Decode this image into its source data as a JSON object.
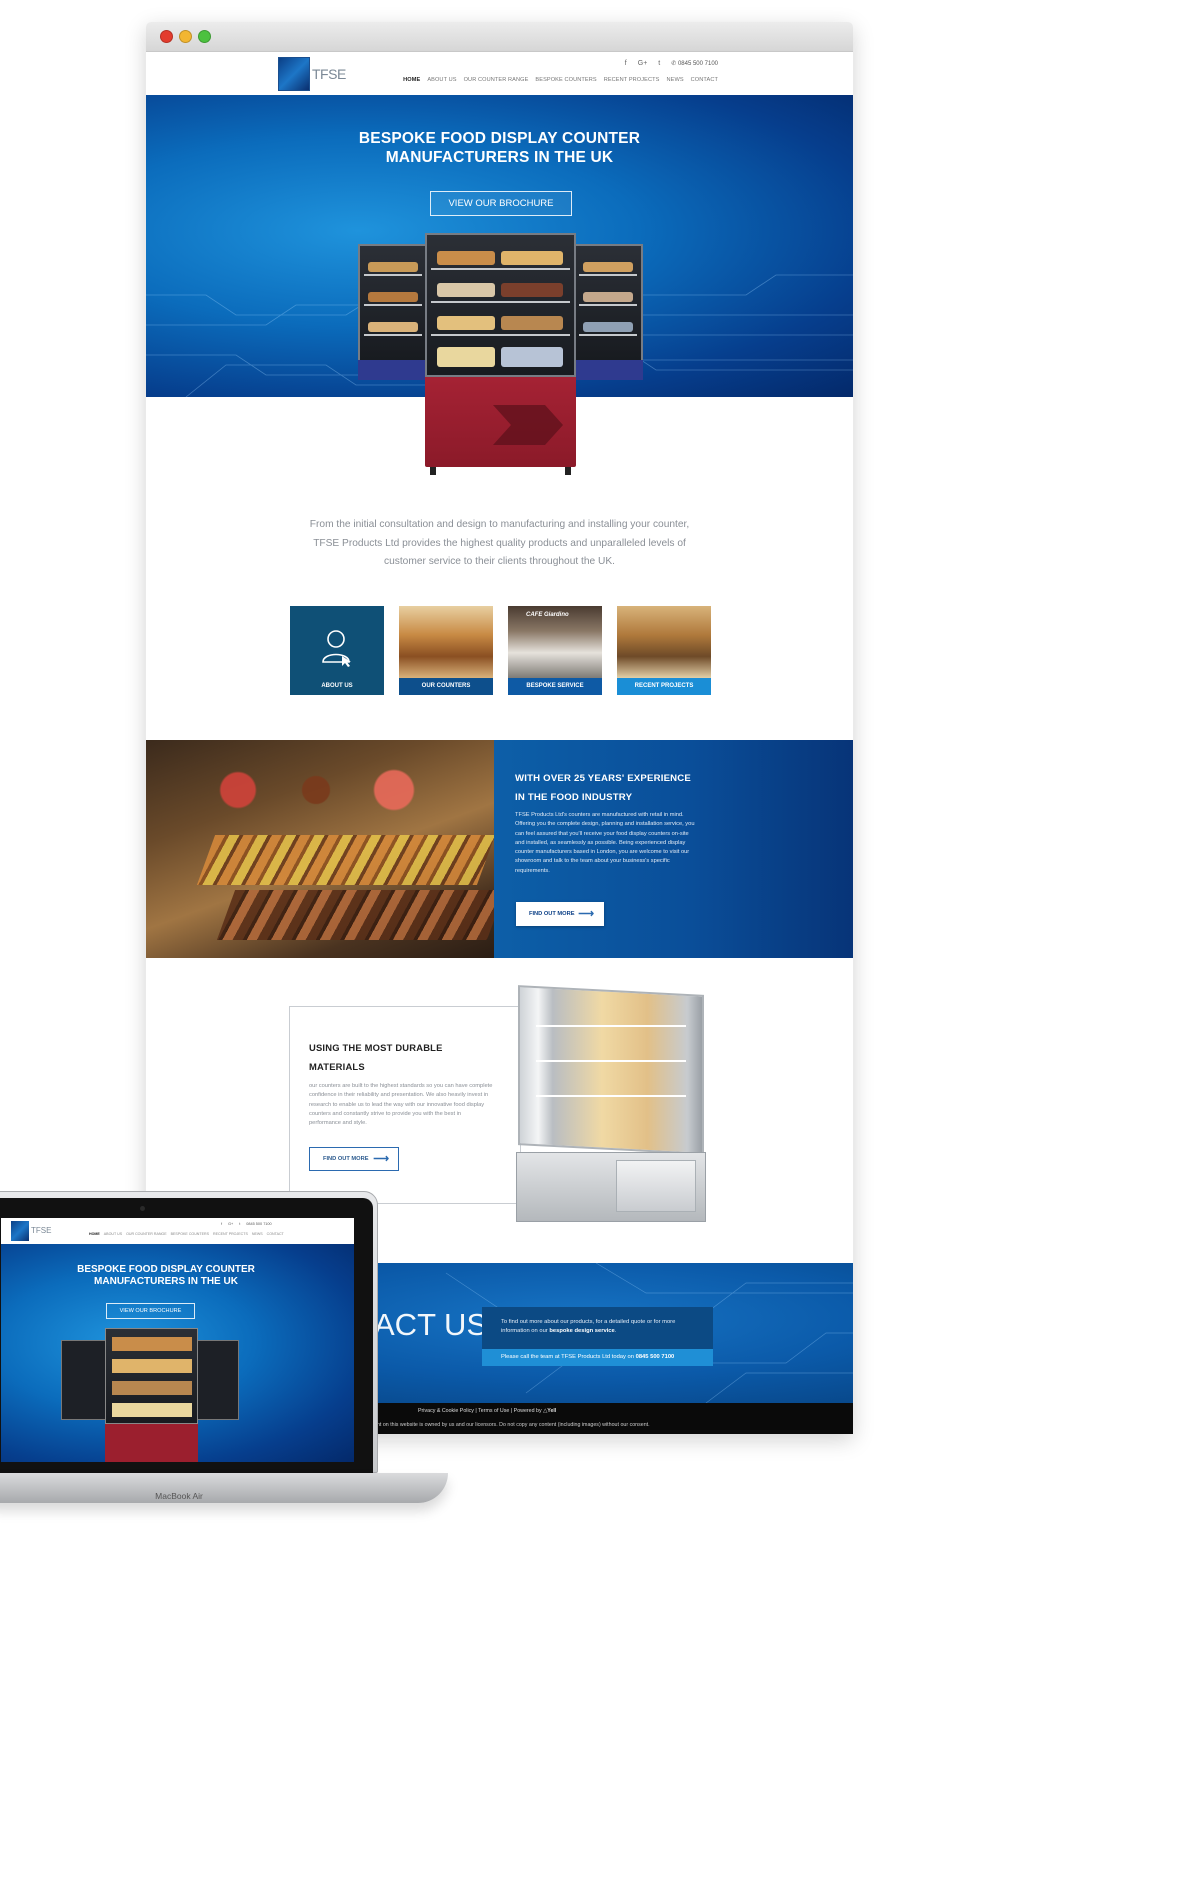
{
  "header": {
    "logo_text": "TFSE",
    "phone": "0845 500 7100",
    "social": [
      "f",
      "G+",
      "t"
    ],
    "nav": [
      "HOME",
      "ABOUT US",
      "OUR COUNTER RANGE",
      "BESPOKE COUNTERS",
      "RECENT PROJECTS",
      "NEWS",
      "CONTACT"
    ]
  },
  "hero": {
    "title_line1": "BESPOKE FOOD DISPLAY COUNTER",
    "title_line2": "MANUFACTURERS IN THE UK",
    "button": "VIEW OUR BROCHURE"
  },
  "intro": {
    "line1": "From the initial consultation and design to manufacturing and installing your counter,",
    "line2": "TFSE Products Ltd provides the highest quality products and unparalleled levels of",
    "line3": "customer service to their clients throughout the UK."
  },
  "tiles": [
    {
      "label": "ABOUT US",
      "color": "#0f5076"
    },
    {
      "label": "OUR COUNTERS",
      "color": "#0d4f8c"
    },
    {
      "label": "BESPOKE SERVICE",
      "color": "#0e5aa5"
    },
    {
      "label": "RECENT PROJECTS",
      "color": "#1a8ed6"
    }
  ],
  "tile_sign": "CAFE Giardino",
  "experience": {
    "title_line1": "WITH OVER 25 YEARS' EXPERIENCE",
    "title_line2": "IN THE FOOD INDUSTRY",
    "body": "TFSE Products Ltd's counters are manufactured with retail in mind. Offering you the complete design, planning and installation service, you can feel assured that you'll receive your food display counters on-site and installed, as seamlessly as possible. Being experienced display counter manufacturers based in London, you are welcome to visit our showroom and talk to the team about your business's specific requirements.",
    "button": "FIND OUT MORE"
  },
  "materials": {
    "title_line1": "USING THE MOST DURABLE",
    "title_line2": "MATERIALS",
    "body": "our counters are built to the highest standards so you can have complete confidence in their reliability and presentation. We also heavily invest in research to enable us to lead the way with our innovative food display counters and constantly strive to provide you with the best in performance and style.",
    "button": "FIND OUT MORE"
  },
  "contact": {
    "big": "ACT US",
    "text_pre": "To find out more about our products, for a detailed quote or for more information on our ",
    "text_bold": "bespoke design service",
    "text_post": ".",
    "call_pre": "Please call the team at TFSE Products Ltd today on ",
    "call_phone": "0845 500 7100"
  },
  "footer": {
    "links": "Privacy & Cookie Policy  |  Terms of Use  |  Powered by",
    "powered": "Yell",
    "copyright": "ent on this website is owned by us and our licensors. Do not copy any content (including images) without our consent."
  },
  "laptop": {
    "label": "MacBook Air",
    "title_line1": "BESPOKE FOOD DISPLAY COUNTER",
    "title_line2": "MANUFACTURERS IN THE UK",
    "button": "VIEW OUR BROCHURE",
    "phone": "0845 500 7100",
    "nav": [
      "HOME",
      "ABOUT US",
      "OUR COUNTER RANGE",
      "BESPOKE COUNTERS",
      "RECENT PROJECTS",
      "NEWS",
      "CONTACT"
    ]
  },
  "colors": {
    "brand_blue": "#0b5aa9",
    "counter_red": "#9b1f2e",
    "accent_light_blue": "#1f8fd6"
  }
}
